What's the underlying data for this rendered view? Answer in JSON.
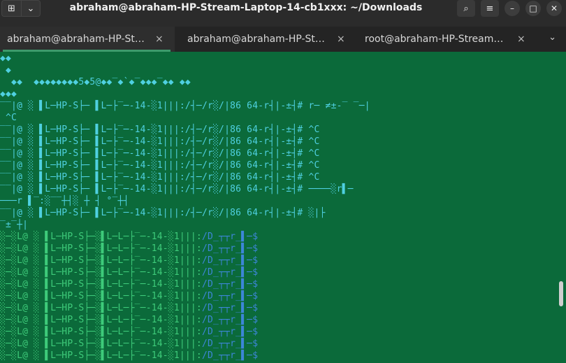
{
  "window": {
    "title": "abraham@abraham-HP-Stream-Laptop-14-cb1xxx: ~/Downloads",
    "new_tab_icon": "plus-box-icon",
    "menu_icon": "chevron-down-icon",
    "search_icon": "search-icon",
    "hamburger_icon": "hamburger-menu-icon",
    "minimize_icon": "minimize-icon",
    "maximize_icon": "maximize-icon",
    "close_icon": "close-icon"
  },
  "tabs": [
    {
      "label": "abraham@abraham-HP-St…",
      "close": "×",
      "active": true
    },
    {
      "label": "abraham@abraham-HP-St…",
      "close": "×",
      "active": false
    },
    {
      "label": "root@abraham-HP-Stream…",
      "close": "×",
      "active": false
    }
  ],
  "terminal": {
    "lines": [
      {
        "text": "◆◆",
        "color": "cyan"
      },
      {
        "text": " ◆",
        "color": "cyan"
      },
      {
        "text": "  ◆◆  ◆◆◆◆◆◆◆◆5◆5@◆◆‾◆`◆‾◆◆◆‾◆◆ ◆◆",
        "color": "cyan"
      },
      {
        "text": "◆◆◆",
        "color": "cyan"
      },
      {
        "text": "‾‾|@ ░ ▌L─HP-S├─ ▌L─├‾─-14-░1|||:/┤─/r░/|86 64-r┤|-±┤# r─ ≠±-‾ ‾─|",
        "color": "cyan"
      },
      {
        "text": " ^C",
        "color": "cyan"
      },
      {
        "text": "‾‾|@ ░ ▌L─HP-S├─ ▌L─├‾─-14-░1|||:/┤─/r░/|86 64-r┤|-±┤# ^C",
        "color": "cyan"
      },
      {
        "text": "‾‾|@ ░ ▌L─HP-S├─ ▌L─├‾─-14-░1|||:/┤─/r░/|86 64-r┤|-±┤# ^C",
        "color": "cyan"
      },
      {
        "text": "‾‾|@ ░ ▌L─HP-S├─ ▌L─├‾─-14-░1|||:/┤─/r░/|86 64-r┤|-±┤# ^C",
        "color": "cyan"
      },
      {
        "text": "‾‾|@ ░ ▌L─HP-S├─ ▌L─├‾─-14-░1|||:/┤─/r░/|86 64-r┤|-±┤# ^C",
        "color": "cyan"
      },
      {
        "text": "‾‾|@ ░ ▌L─HP-S├─ ▌L─├‾─-14-░1|||:/┤─/r░/|86 64-r┤|-±┤# ^C",
        "color": "cyan"
      },
      {
        "text": "‾‾|@ ░ ▌L─HP-S├─ ▌L─├‾─-14-░1|||:/┤─/r░/|86 64-r┤|-±┤# ────░r▌─",
        "color": "cyan"
      },
      {
        "text": "───r ▌‾:░‾‾┼┤░ ┼ ┤ °‾┼┤",
        "color": "cyan"
      },
      {
        "text": "‾‾|@ ░ ▌L─HP-S├─ ▌L─├‾─-14-░1|||:/┤─/r░/|86 64-r┤|-±┤# ░|├",
        "color": "cyan"
      },
      {
        "text": "‾±‾┼|",
        "color": "cyan"
      },
      {
        "text": "░─░L@ ░ ▌L─HP-S├─░▌L─L─├‾─-14-░1|||:",
        "tail": "/D_┬┬r_▌─$",
        "color": "green"
      },
      {
        "text": "░─░L@ ░ ▌L─HP-S├─░▌L─L─├‾─-14-░1|||:",
        "tail": "/D_┬┬r_▌─$",
        "color": "green"
      },
      {
        "text": "░─░L@ ░ ▌L─HP-S├─░▌L─L─├‾─-14-░1|||:",
        "tail": "/D_┬┬r_▌─$",
        "color": "green"
      },
      {
        "text": "░─░L@ ░ ▌L─HP-S├─░▌L─L─├‾─-14-░1|||:",
        "tail": "/D_┬┬r_▌─$",
        "color": "green"
      },
      {
        "text": "░─░L@ ░ ▌L─HP-S├─░▌L─L─├‾─-14-░1|||:",
        "tail": "/D_┬┬r_▌─$",
        "color": "green"
      },
      {
        "text": "░─░L@ ░ ▌L─HP-S├─░▌L─L─├‾─-14-░1|||:",
        "tail": "/D_┬┬r_▌─$",
        "color": "green"
      },
      {
        "text": "░─░L@ ░ ▌L─HP-S├─░▌L─L─├‾─-14-░1|||:",
        "tail": "/D_┬┬r_▌─$",
        "color": "green"
      },
      {
        "text": "░─░L@ ░ ▌L─HP-S├─░▌L─L─├‾─-14-░1|||:",
        "tail": "/D_┬┬r_▌─$",
        "color": "green"
      },
      {
        "text": "░─░L@ ░ ▌L─HP-S├─░▌L─L─├‾─-14-░1|||:",
        "tail": "/D_┬┬r_▌─$",
        "color": "green"
      },
      {
        "text": "░─░L@ ░ ▌L─HP-S├─░▌L─L─├‾─-14-░1|||:",
        "tail": "/D_┬┬r_▌─$",
        "color": "green"
      },
      {
        "text": "░─░L@ ░ ▌L─HP-S├─░▌L─L─├‾─-14-░1|||:",
        "tail": "/D_┬┬r_▌─$",
        "color": "green"
      }
    ]
  },
  "colors": {
    "terminal_bg": "#0b6a3a",
    "cyan_text": "#4fd0e0",
    "green_text": "#3ecb7a",
    "blue_text": "#3d86d8",
    "tab_accent": "#3d9a6b"
  }
}
